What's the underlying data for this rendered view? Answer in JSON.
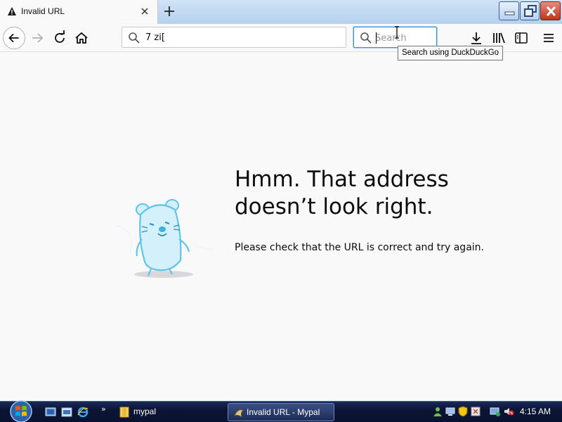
{
  "tab": {
    "title": "Invalid URL",
    "icon": "warning-icon"
  },
  "navbar": {
    "url_value": "7 zi[",
    "search_placeholder": "Search",
    "search_tooltip": "Search using DuckDuckGo"
  },
  "error": {
    "title": "Hmm. That address doesn’t look right.",
    "description": "Please check that the URL is correct and try again."
  },
  "taskbar": {
    "folder_label": "mypal",
    "task_label": "Invalid URL - Mypal",
    "clock": "4:15 AM",
    "overflow": "»"
  },
  "colors": {
    "accent": "#3b8fe0",
    "taskbar": "#0b1533",
    "close_button": "#c0331a"
  }
}
